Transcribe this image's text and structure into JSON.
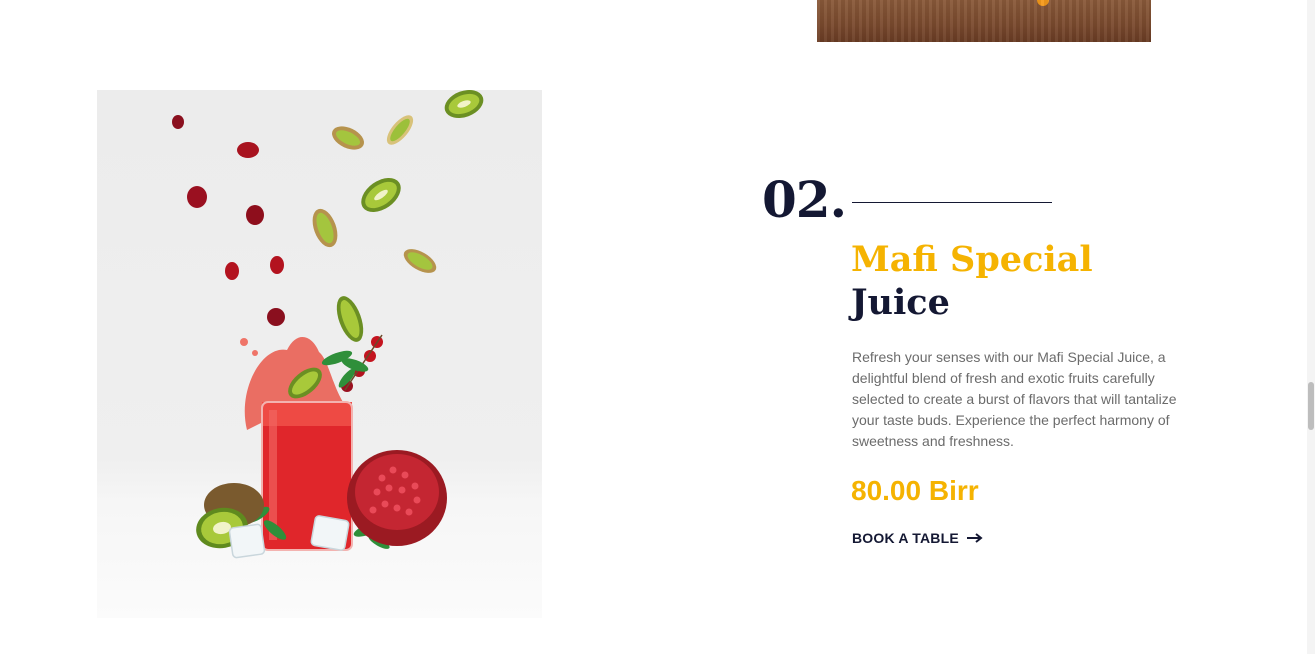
{
  "menu_item": {
    "number": "02.",
    "title_accent": "Mafi Special",
    "title_rest": "Juice",
    "description": "Refresh your senses with our Mafi Special Juice, a delightful blend of fresh and exotic fruits carefully selected to create a burst of flavors that will tantalize your taste buds. Experience the perfect harmony of sweetness and freshness.",
    "price": "80.00 Birr",
    "cta_label": "BOOK A TABLE",
    "cta_icon": "arrow-right-icon"
  },
  "colors": {
    "accent": "#f5b301",
    "dark": "#141833",
    "body_text": "#6b6b6b",
    "background": "#ffffff"
  }
}
